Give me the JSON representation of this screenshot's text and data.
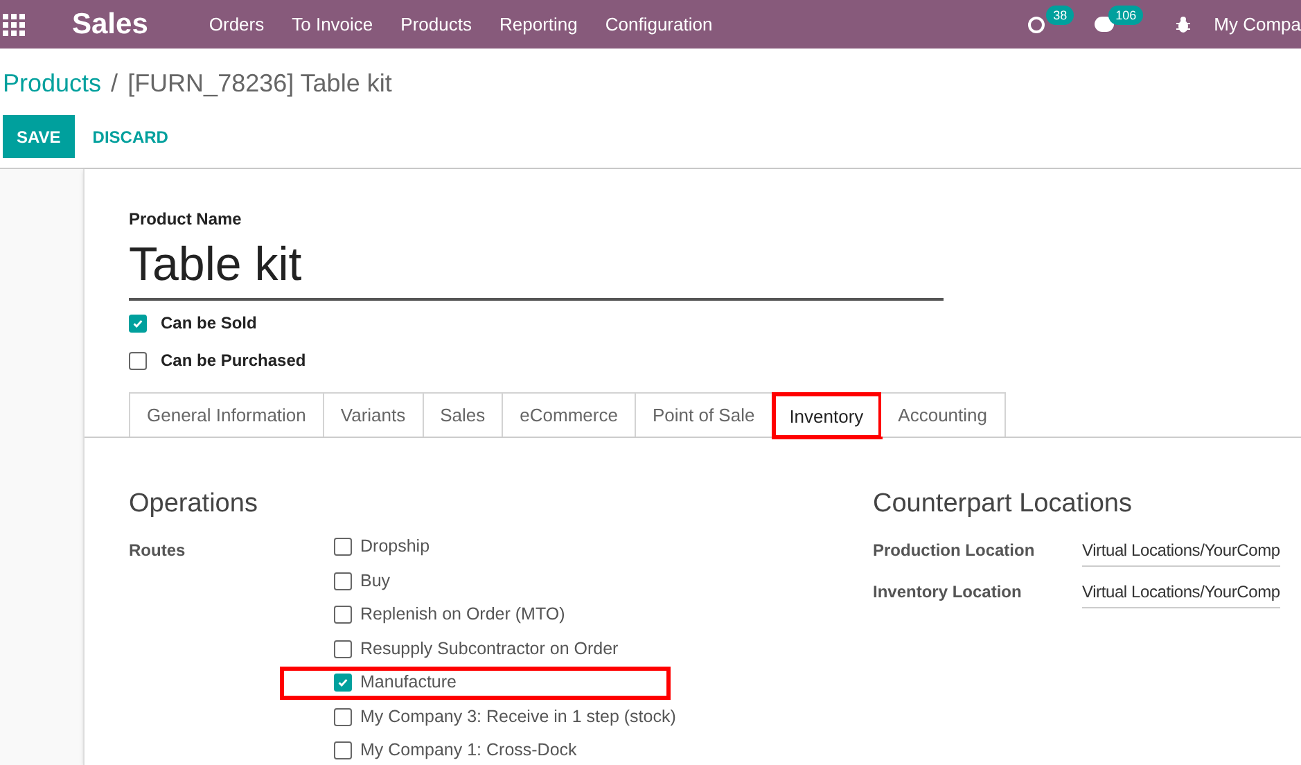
{
  "navbar": {
    "app": "Sales",
    "menu": [
      "Orders",
      "To Invoice",
      "Products",
      "Reporting",
      "Configuration"
    ],
    "activity_count": "38",
    "messages_count": "106",
    "company": "My Compa"
  },
  "breadcrumb": {
    "parent": "Products",
    "separator": "/",
    "current": "[FURN_78236] Table kit"
  },
  "buttons": [
    "SAVE",
    "DISCARD"
  ],
  "product": {
    "name_label": "Product Name",
    "name": "Table kit",
    "options": [
      {
        "label": "Can be Sold",
        "checked": true
      },
      {
        "label": "Can be Purchased",
        "checked": false
      }
    ]
  },
  "tabs": [
    {
      "label": "General Information",
      "selected": false,
      "highlighted": false
    },
    {
      "label": "Variants",
      "selected": false,
      "highlighted": false
    },
    {
      "label": "Sales",
      "selected": false,
      "highlighted": false
    },
    {
      "label": "eCommerce",
      "selected": false,
      "highlighted": false
    },
    {
      "label": "Point of Sale",
      "selected": false,
      "highlighted": false
    },
    {
      "label": "Inventory",
      "selected": true,
      "highlighted": true
    },
    {
      "label": "Accounting",
      "selected": false,
      "highlighted": false
    }
  ],
  "operations": {
    "title": "Operations",
    "routes_label": "Routes",
    "routes": [
      {
        "label": "Dropship",
        "checked": false,
        "highlighted": false
      },
      {
        "label": "Buy",
        "checked": false,
        "highlighted": false
      },
      {
        "label": "Replenish on Order (MTO)",
        "checked": false,
        "highlighted": false
      },
      {
        "label": "Resupply Subcontractor on Order",
        "checked": false,
        "highlighted": false
      },
      {
        "label": "Manufacture",
        "checked": true,
        "highlighted": true
      },
      {
        "label": "My Company 3: Receive in 1 step (stock)",
        "checked": false,
        "highlighted": false
      },
      {
        "label": "My Company 1: Cross-Dock",
        "checked": false,
        "highlighted": false
      }
    ]
  },
  "counterpart": {
    "title": "Counterpart Locations",
    "fields": [
      {
        "label": "Production Location",
        "value": "Virtual Locations/YourComp"
      },
      {
        "label": "Inventory Location",
        "value": "Virtual Locations/YourComp"
      }
    ]
  }
}
